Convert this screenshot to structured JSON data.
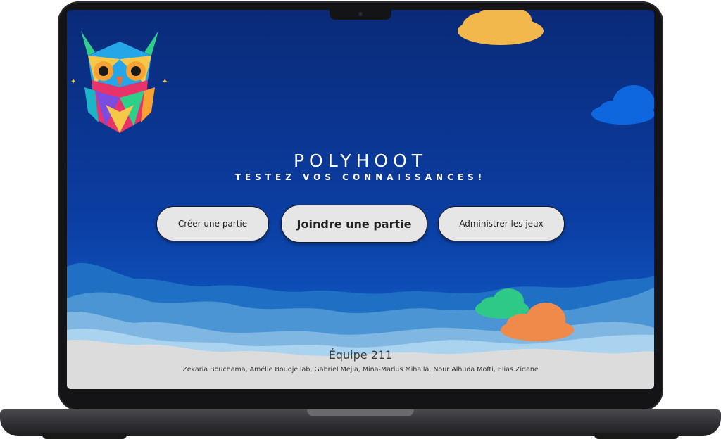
{
  "app": {
    "title": "POLYHOOT",
    "subtitle": "TESTEZ VOS CONNAISSANCES!"
  },
  "buttons": {
    "create": "Créer une partie",
    "join": "Joindre une partie",
    "admin": "Administrer les jeux"
  },
  "footer": {
    "team": "Équipe 211",
    "members": "Zekaria Bouchama, Amélie Boudjellab, Gabriel Mejia, Mina-Marius Mihaila, Nour Alhuda Mofti, Elias Zidane"
  },
  "icons": {
    "logo": "owl-logo-icon"
  },
  "colors": {
    "sky_top": "#0a2a78",
    "sky_bottom": "#0d4fb8",
    "cloud_yellow": "#f2b84b",
    "cloud_blue": "#0f67e0",
    "cloud_green": "#2ec987",
    "cloud_orange": "#f08a4b",
    "button_bg": "#e6e6e6"
  }
}
